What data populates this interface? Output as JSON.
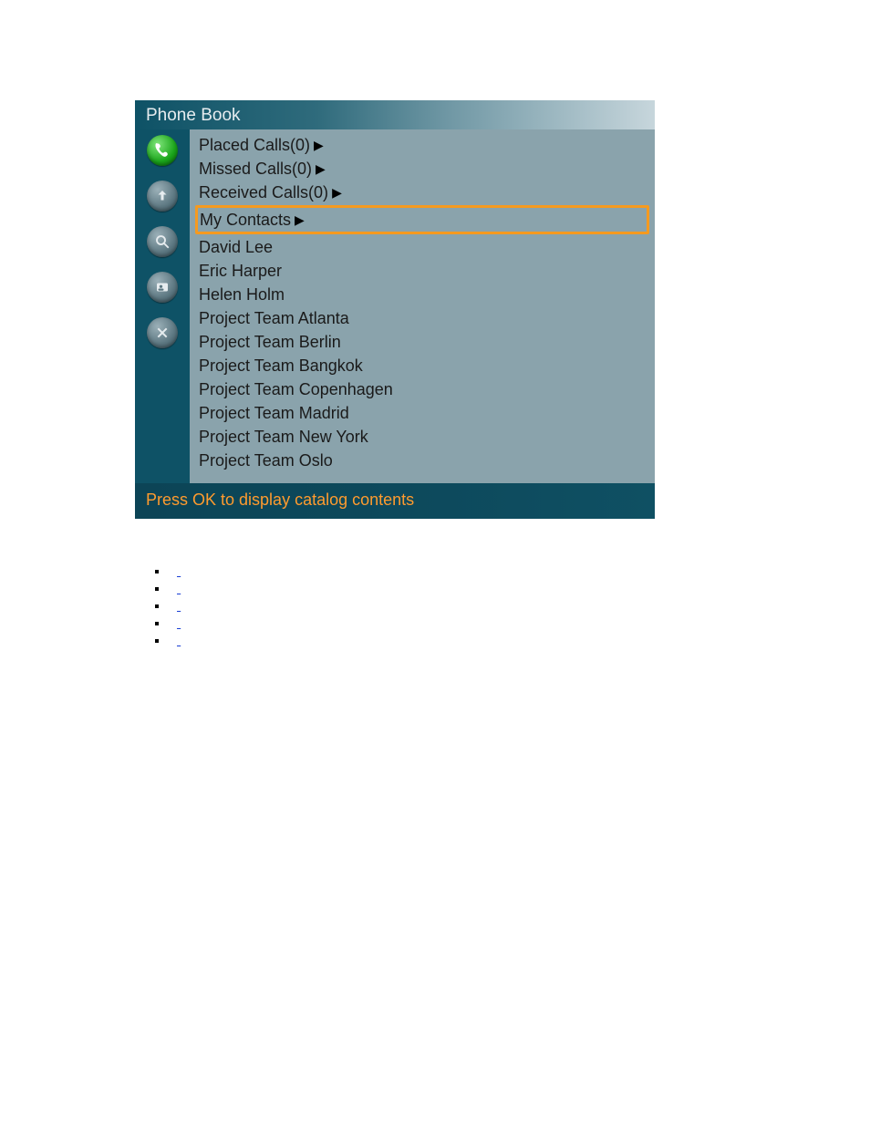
{
  "phonebook": {
    "title": "Phone Book",
    "icons": [
      "phone-icon",
      "up-folder-icon",
      "search-icon",
      "new-contact-icon",
      "close-icon"
    ],
    "rows": [
      {
        "label": "Placed Calls(0)",
        "hasArrow": true,
        "selected": false
      },
      {
        "label": "Missed Calls(0)",
        "hasArrow": true,
        "selected": false
      },
      {
        "label": "Received Calls(0)",
        "hasArrow": true,
        "selected": false
      },
      {
        "label": "My Contacts",
        "hasArrow": true,
        "selected": true
      },
      {
        "label": "David Lee",
        "hasArrow": false,
        "selected": false
      },
      {
        "label": "Eric Harper",
        "hasArrow": false,
        "selected": false
      },
      {
        "label": "Helen Holm",
        "hasArrow": false,
        "selected": false
      },
      {
        "label": "Project Team Atlanta",
        "hasArrow": false,
        "selected": false
      },
      {
        "label": "Project Team Berlin",
        "hasArrow": false,
        "selected": false
      },
      {
        "label": "Project Team Bangkok",
        "hasArrow": false,
        "selected": false
      },
      {
        "label": "Project Team Copenhagen",
        "hasArrow": false,
        "selected": false
      },
      {
        "label": "Project Team Madrid",
        "hasArrow": false,
        "selected": false
      },
      {
        "label": "Project Team New York",
        "hasArrow": false,
        "selected": false
      },
      {
        "label": "Project Team Oslo",
        "hasArrow": false,
        "selected": false
      }
    ],
    "footer": "Press OK to display catalog contents"
  },
  "links": {
    "items": [
      {
        "text": " ",
        "widthClass": "lw1"
      },
      {
        "text": " ",
        "widthClass": "lw2"
      },
      {
        "text": " ",
        "widthClass": "lw3"
      },
      {
        "text": " ",
        "widthClass": "lw4"
      },
      {
        "text": " ",
        "widthClass": "lw5"
      }
    ]
  }
}
